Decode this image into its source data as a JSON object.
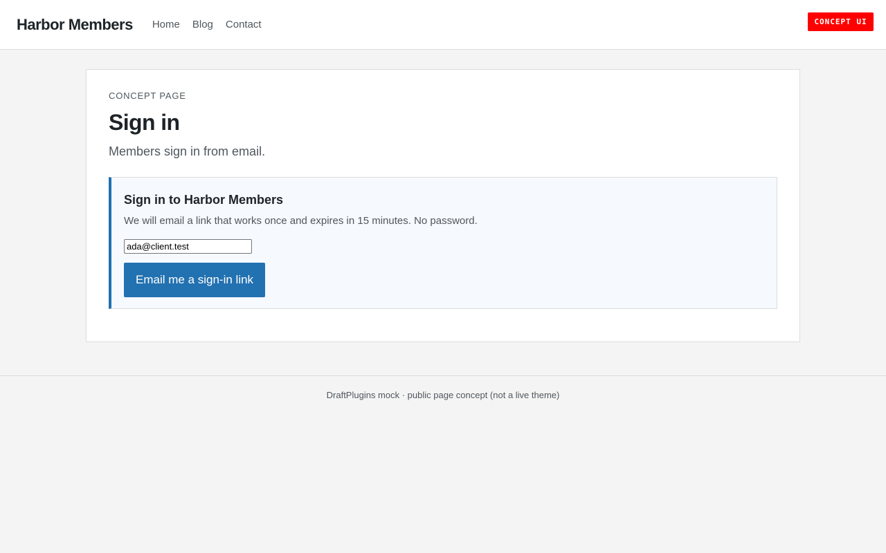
{
  "header": {
    "site_title": "Harbor Members",
    "nav": [
      {
        "label": "Home"
      },
      {
        "label": "Blog"
      },
      {
        "label": "Contact"
      }
    ],
    "badge": "CONCEPT UI"
  },
  "main": {
    "eyebrow": "CONCEPT PAGE",
    "title": "Sign in",
    "subtitle": "Members sign in from email.",
    "panel": {
      "title": "Sign in to Harbor Members",
      "description": "We will email a link that works once and expires in 15 minutes. No password.",
      "email_value": "ada@client.test",
      "button_label": "Email me a sign-in link"
    }
  },
  "footer": {
    "text": "DraftPlugins mock · public page concept (not a live theme)"
  },
  "colors": {
    "accent": "#2271b1",
    "badge": "#ff0000",
    "panel_bg": "#f6f9fd",
    "page_bg": "#f4f4f4"
  }
}
